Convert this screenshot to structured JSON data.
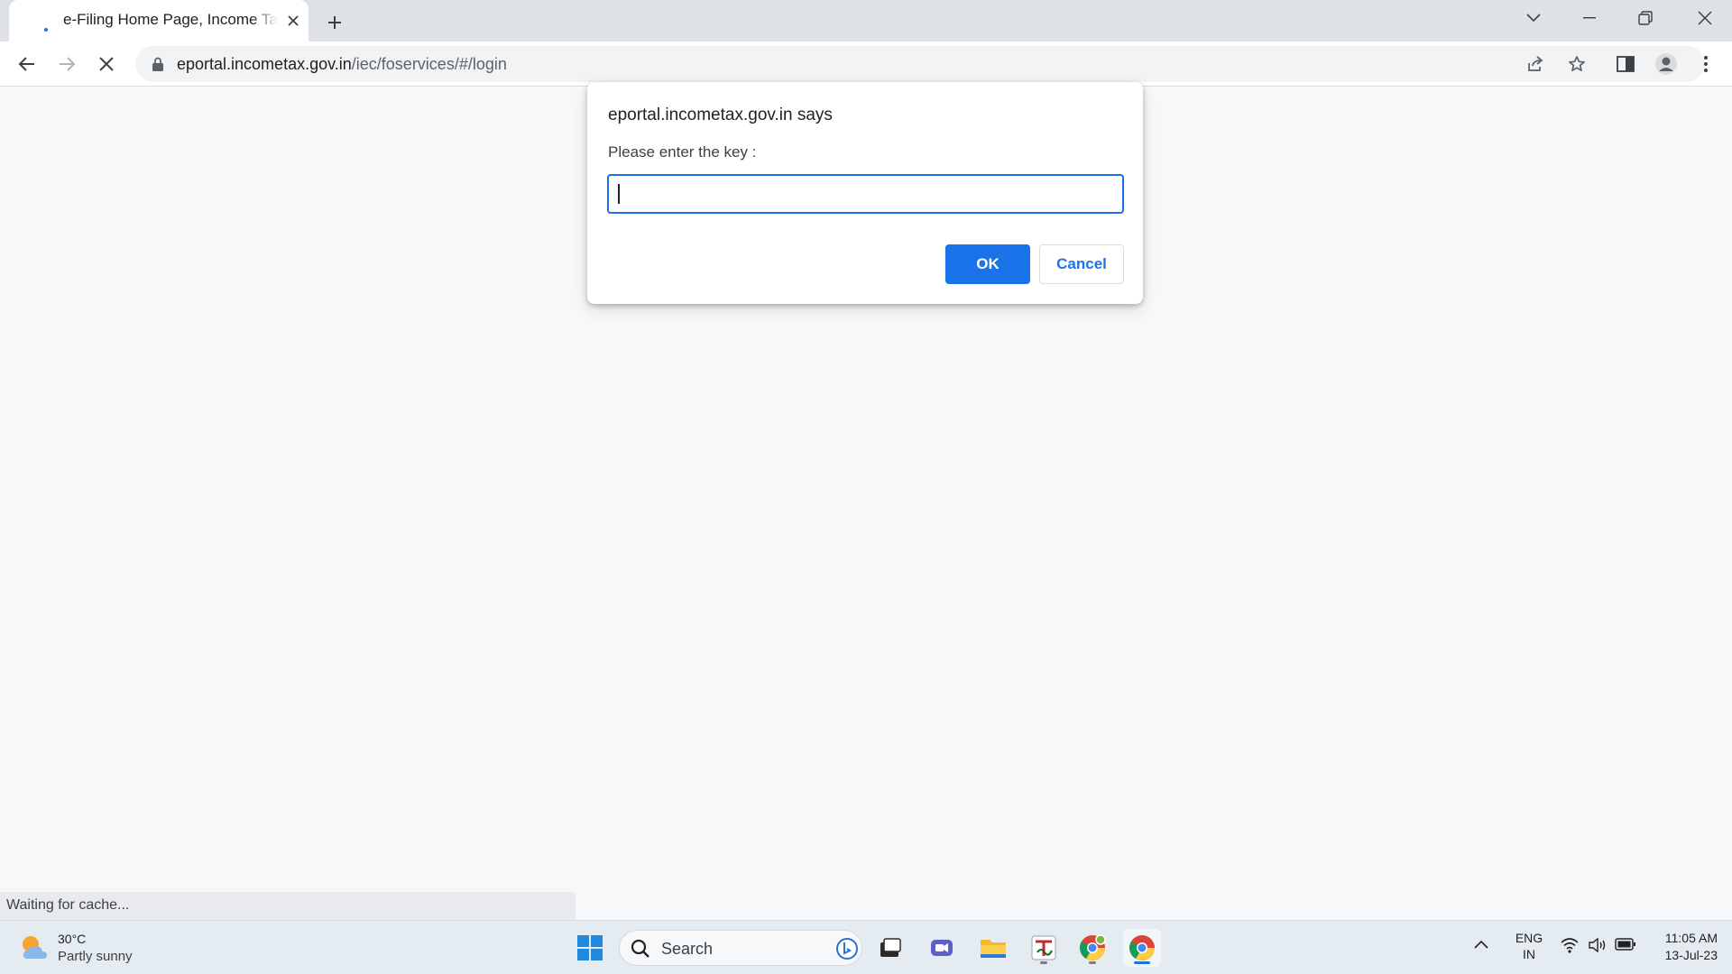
{
  "browser": {
    "tab": {
      "title": "e-Filing Home Page, Income Tax Department"
    },
    "address": {
      "host": "eportal.incometax.gov.in",
      "path": "/iec/foservices/#/login"
    }
  },
  "dialog": {
    "title": "eportal.incometax.gov.in says",
    "message": "Please enter the key :",
    "input_value": "",
    "ok_label": "OK",
    "cancel_label": "Cancel",
    "accent_color": "#1a73e8"
  },
  "status_bar": {
    "text": "Waiting for cache..."
  },
  "taskbar": {
    "weather": {
      "temperature": "30°C",
      "description": "Partly sunny"
    },
    "search_label": "Search",
    "pinned_apps": [
      "windows-start",
      "search",
      "bing-chat",
      "task-view",
      "teams-meet",
      "file-explorer",
      "tally",
      "chrome-profile",
      "chrome"
    ],
    "language": {
      "line1": "ENG",
      "line2": "IN"
    },
    "clock": {
      "time": "11:05 AM",
      "date": "13-Jul-23"
    }
  }
}
